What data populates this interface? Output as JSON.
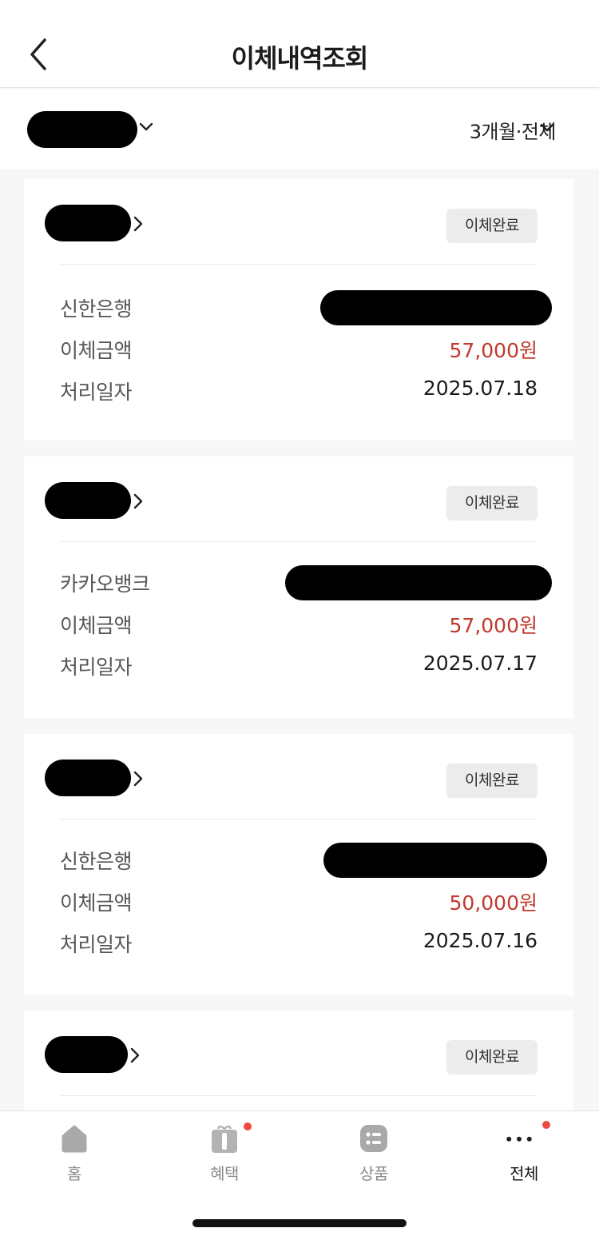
{
  "header": {
    "title": "이체내역조회"
  },
  "filter": {
    "period_label": "3개월·전체"
  },
  "transfers": [
    {
      "status": "이체완료",
      "bank": "신한은행",
      "amount_label": "이체금액",
      "amount": "57,000원",
      "date_label": "처리일자",
      "date": "2025.07.18"
    },
    {
      "status": "이체완료",
      "bank": "카카오뱅크",
      "amount_label": "이체금액",
      "amount": "57,000원",
      "date_label": "처리일자",
      "date": "2025.07.17"
    },
    {
      "status": "이체완료",
      "bank": "신한은행",
      "amount_label": "이체금액",
      "amount": "50,000원",
      "date_label": "처리일자",
      "date": "2025.07.16"
    },
    {
      "status": "이체완료"
    }
  ],
  "tabbar": {
    "items": [
      {
        "label": "홈",
        "icon": "home-icon",
        "active": false,
        "badge": false
      },
      {
        "label": "혜택",
        "icon": "gift-icon",
        "active": false,
        "badge": true
      },
      {
        "label": "상품",
        "icon": "list-icon",
        "active": false,
        "badge": false
      },
      {
        "label": "전체",
        "icon": "more-icon",
        "active": true,
        "badge": true
      }
    ]
  },
  "colors": {
    "amount": "#c0392b",
    "badge_dot": "#ee4b3e",
    "redaction": "#000000"
  }
}
